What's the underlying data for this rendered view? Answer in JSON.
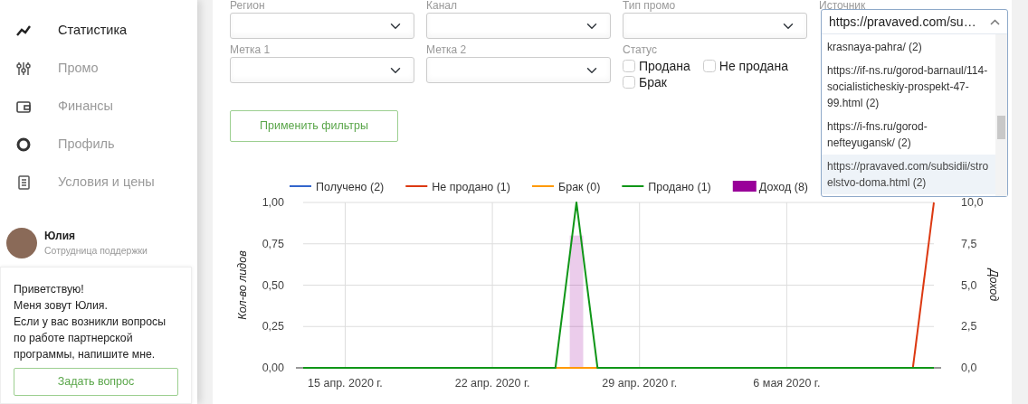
{
  "sidebar": {
    "items": [
      {
        "label": "Статистика",
        "selected": true
      },
      {
        "label": "Промо",
        "selected": false
      },
      {
        "label": "Финансы",
        "selected": false
      },
      {
        "label": "Профиль",
        "selected": false
      },
      {
        "label": "Условия и цены",
        "selected": false
      }
    ]
  },
  "support": {
    "name": "Юлия",
    "role": "Сотрудница поддержки",
    "message": "Приветствую!\nМеня зовут Юлия.\nЕсли у вас возникли вопросы\nпо работе партнерской\nпрограммы, напишите мне.",
    "button": "Задать вопрос"
  },
  "filters": {
    "selects": [
      {
        "label": "Регион"
      },
      {
        "label": "Канал"
      },
      {
        "label": "Тип промо"
      },
      {
        "label": "Метка 1"
      },
      {
        "label": "Метка 2"
      }
    ],
    "status": {
      "label": "Статус",
      "options": [
        {
          "label": "Продана",
          "checked": false
        },
        {
          "label": "Не продана",
          "checked": false
        },
        {
          "label": "Брак",
          "checked": false
        }
      ]
    },
    "source": {
      "label": "Источник",
      "value": "https://pravaved.com/su…",
      "expanded": true,
      "options": [
        {
          "label": "krasnaya-pahra/ (2)",
          "selected": false
        },
        {
          "label": "https://if-ns.ru/gorod-barnaul/114-socialisticheskiy-prospekt-47-99.html (2)",
          "selected": false
        },
        {
          "label": "https://i-fns.ru/gorod-nefteyugansk/ (2)",
          "selected": false
        },
        {
          "label": "https://pravaved.com/subsidii/stroelstvo-doma.html (2)",
          "selected": true
        }
      ]
    },
    "apply_button": "Применить фильтры"
  },
  "chart": {
    "chart_data": {
      "type": "line",
      "ylabel": "Кол-во лидов",
      "y2label": "Доход",
      "categories": [
        null,
        null,
        "15 апр. 2020 г.",
        null,
        null,
        null,
        null,
        null,
        null,
        "22 апр. 2020 г.",
        null,
        null,
        null,
        null,
        null,
        null,
        "29 апр. 2020 г.",
        null,
        null,
        null,
        null,
        null,
        null,
        "6 мая 2020 г.",
        null,
        null,
        null,
        null,
        null,
        null,
        null
      ],
      "ylim": [
        0,
        1
      ],
      "y2lim": [
        0,
        10
      ],
      "grid": true,
      "legend": "top",
      "yticks": [
        {
          "value": 0,
          "label": "0,00"
        },
        {
          "value": 0.25,
          "label": "0,25"
        },
        {
          "value": 0.5,
          "label": "0,50"
        },
        {
          "value": 0.75,
          "label": "0,75"
        },
        {
          "value": 1,
          "label": "1,00"
        }
      ],
      "y2ticks": [
        {
          "value": 0,
          "label": "0,0"
        },
        {
          "value": 2.5,
          "label": "2,5"
        },
        {
          "value": 5,
          "label": "5,0"
        },
        {
          "value": 7.5,
          "label": "7,5"
        },
        {
          "value": 10,
          "label": "10,0"
        }
      ],
      "series": [
        {
          "name": "Получено (2)",
          "color": "#3366cc",
          "values": [
            null,
            null,
            null,
            null,
            null,
            null,
            null,
            null,
            null,
            null,
            null,
            null,
            null,
            null,
            null,
            null,
            null,
            null,
            null,
            null,
            null,
            null,
            null,
            null,
            null,
            null,
            null,
            null,
            null,
            null,
            null
          ]
        },
        {
          "name": "Не продано (1)",
          "color": "#dc3912",
          "values": [
            null,
            null,
            null,
            null,
            null,
            null,
            null,
            null,
            null,
            null,
            null,
            null,
            null,
            null,
            null,
            null,
            null,
            null,
            null,
            null,
            null,
            null,
            null,
            null,
            null,
            null,
            null,
            null,
            null,
            0,
            1
          ]
        },
        {
          "name": "Брак (0)",
          "color": "#ff9900",
          "values": [
            null,
            null,
            null,
            null,
            null,
            null,
            null,
            null,
            null,
            null,
            null,
            null,
            0,
            0,
            0,
            null,
            null,
            null,
            null,
            null,
            null,
            null,
            null,
            null,
            null,
            null,
            null,
            null,
            null,
            null,
            null
          ]
        },
        {
          "name": "Продано (1)",
          "color": "#109618",
          "values": [
            0,
            0,
            0,
            0,
            0,
            0,
            0,
            0,
            0,
            0,
            0,
            0,
            0,
            1,
            0,
            0,
            0,
            0,
            0,
            0,
            0,
            0,
            0,
            0,
            0,
            0,
            0,
            0,
            0,
            0,
            0
          ]
        },
        {
          "name": "Доход (8)",
          "color": "#990099",
          "type": "bar",
          "axis": "y2",
          "values": [
            null,
            null,
            null,
            null,
            null,
            null,
            null,
            null,
            null,
            null,
            null,
            null,
            null,
            8,
            null,
            null,
            null,
            null,
            null,
            null,
            null,
            null,
            null,
            null,
            null,
            null,
            null,
            null,
            null,
            null,
            null
          ]
        }
      ]
    }
  }
}
